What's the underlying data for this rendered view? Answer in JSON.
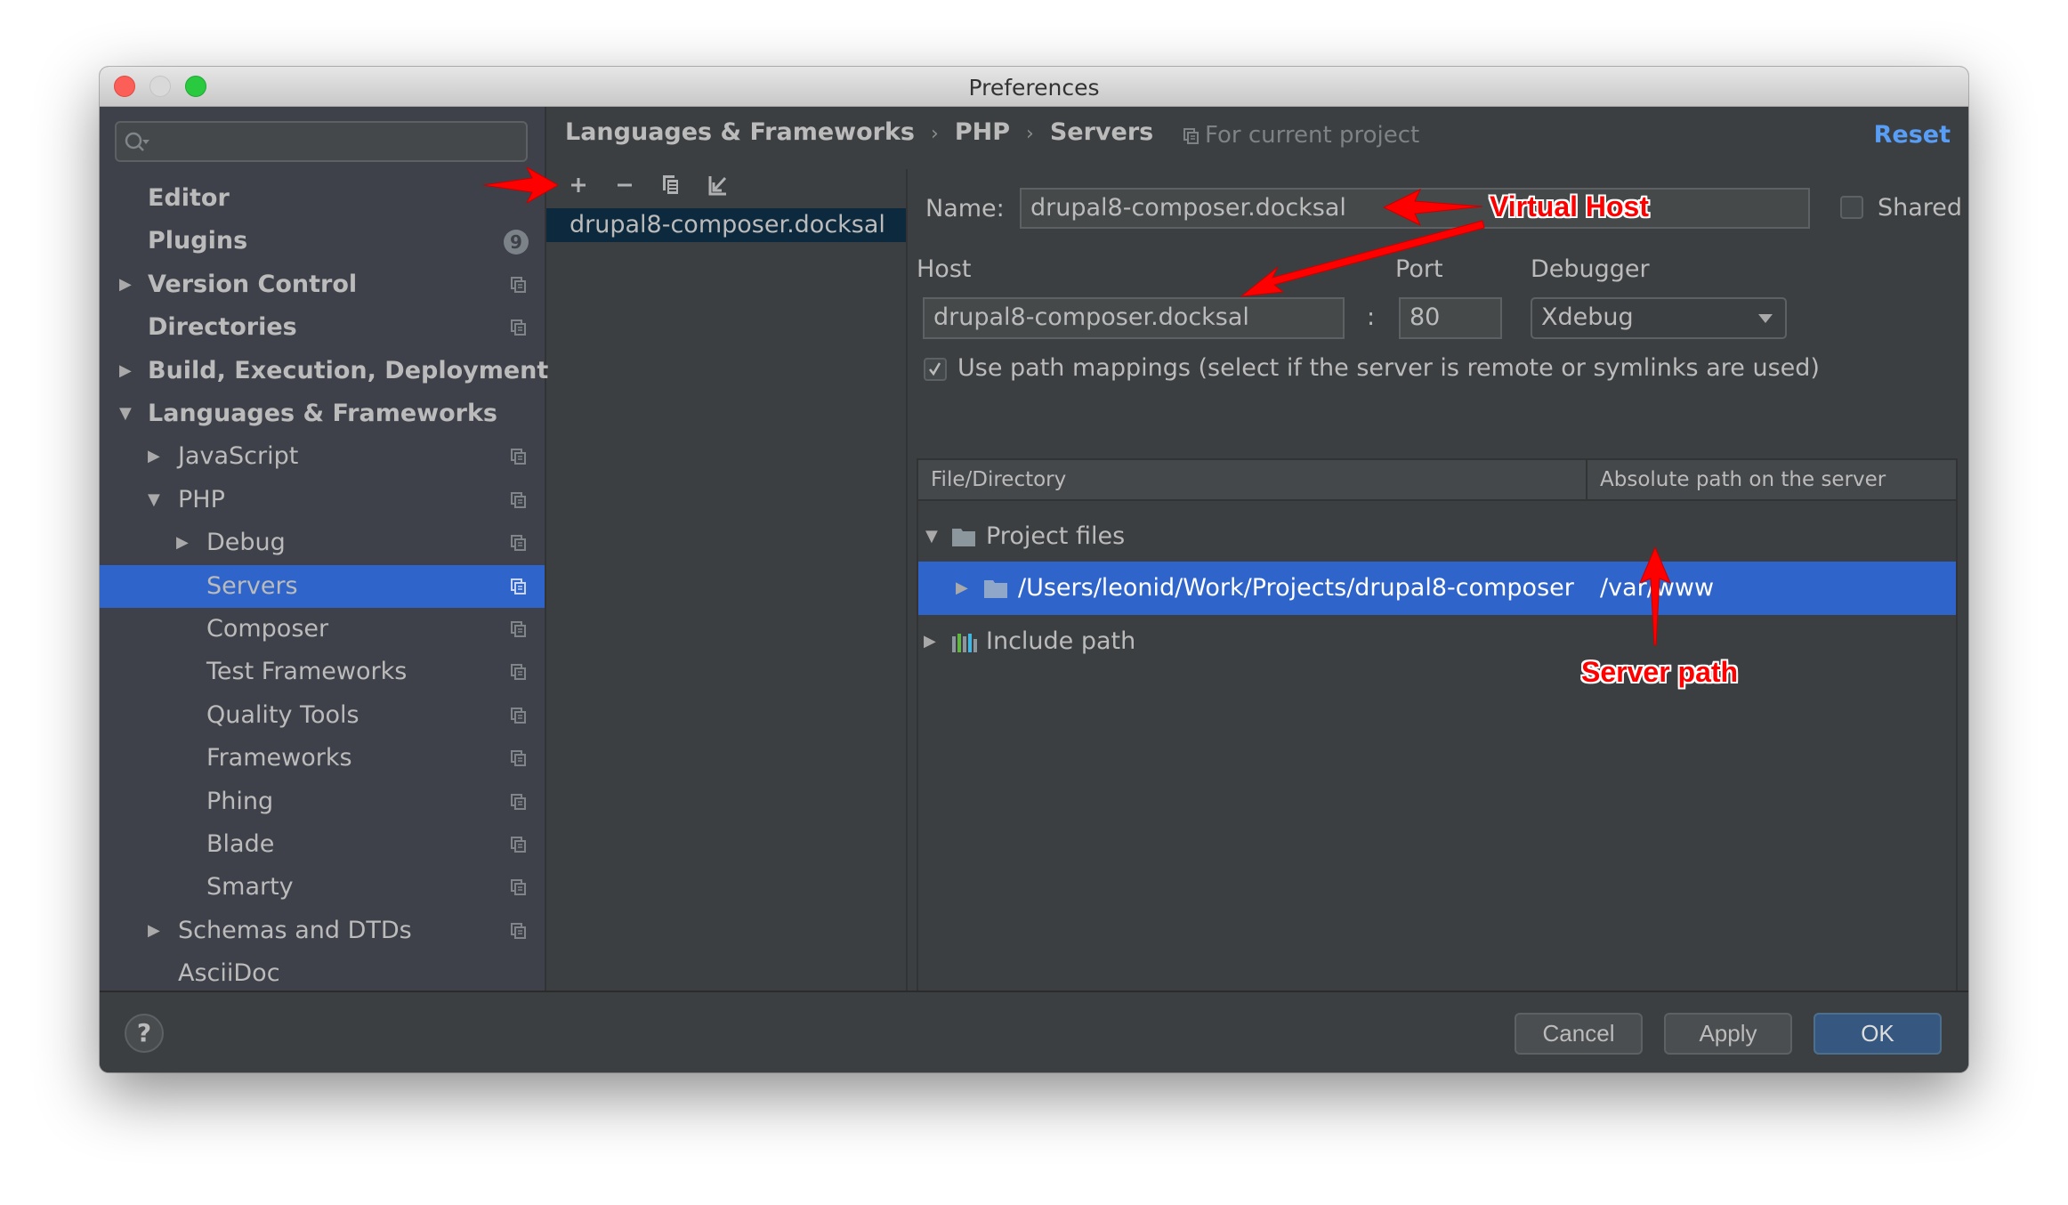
{
  "window": {
    "title": "Preferences",
    "controls": [
      "close",
      "minimize",
      "maximize"
    ]
  },
  "sidebar": {
    "search": {
      "value": "",
      "placeholder": ""
    },
    "items": [
      {
        "label": "Editor",
        "level": 0,
        "expander": "none",
        "bold": true,
        "project_icon": false
      },
      {
        "label": "Plugins",
        "level": 0,
        "expander": "none",
        "bold": true,
        "badge": "9"
      },
      {
        "label": "Version Control",
        "level": 0,
        "expander": "collapsed",
        "bold": true,
        "project_icon": true
      },
      {
        "label": "Directories",
        "level": 0,
        "expander": "none",
        "bold": true,
        "project_icon": true
      },
      {
        "label": "Build, Execution, Deployment",
        "level": 0,
        "expander": "collapsed",
        "bold": true,
        "project_icon": false
      },
      {
        "label": "Languages & Frameworks",
        "level": 0,
        "expander": "expanded",
        "bold": true,
        "project_icon": false
      },
      {
        "label": "JavaScript",
        "level": 1,
        "expander": "collapsed",
        "project_icon": true
      },
      {
        "label": "PHP",
        "level": 1,
        "expander": "expanded",
        "project_icon": true
      },
      {
        "label": "Debug",
        "level": 2,
        "expander": "collapsed",
        "project_icon": true
      },
      {
        "label": "Servers",
        "level": 2,
        "expander": "none",
        "project_icon": true,
        "selected": true
      },
      {
        "label": "Composer",
        "level": 2,
        "expander": "none",
        "project_icon": true
      },
      {
        "label": "Test Frameworks",
        "level": 2,
        "expander": "none",
        "project_icon": true
      },
      {
        "label": "Quality Tools",
        "level": 2,
        "expander": "none",
        "project_icon": true
      },
      {
        "label": "Frameworks",
        "level": 2,
        "expander": "none",
        "project_icon": true
      },
      {
        "label": "Phing",
        "level": 2,
        "expander": "none",
        "project_icon": true
      },
      {
        "label": "Blade",
        "level": 2,
        "expander": "none",
        "project_icon": true
      },
      {
        "label": "Smarty",
        "level": 2,
        "expander": "none",
        "project_icon": true
      },
      {
        "label": "Schemas and DTDs",
        "level": 1,
        "expander": "collapsed",
        "project_icon": true
      },
      {
        "label": "AsciiDoc",
        "level": 1,
        "expander": "none",
        "project_icon": false
      }
    ]
  },
  "header": {
    "breadcrumb": [
      "Languages & Frameworks",
      "PHP",
      "Servers"
    ],
    "breadcrumb_separator": "›",
    "scope_label": "For current project",
    "reset_label": "Reset"
  },
  "servers_list": {
    "toolbar": [
      {
        "name": "add",
        "icon": "plus-icon",
        "glyph": "+"
      },
      {
        "name": "remove",
        "icon": "minus-icon",
        "glyph": "−"
      },
      {
        "name": "copy",
        "icon": "copy-icon"
      },
      {
        "name": "import",
        "icon": "import-icon"
      }
    ],
    "items": [
      {
        "label": "drupal8-composer.docksal",
        "selected": true
      }
    ]
  },
  "server_form": {
    "name_label": "Name:",
    "name_value": "drupal8-composer.docksal",
    "shared_label": "Shared",
    "shared_checked": false,
    "host_label": "Host",
    "host_value": "drupal8-composer.docksal",
    "port_label": "Port",
    "port_separator": ":",
    "port_value": "80",
    "debugger_label": "Debugger",
    "debugger_value": "Xdebug",
    "path_mappings_label": "Use path mappings (select if the server is remote or symlinks are used)",
    "path_mappings_checked": true
  },
  "mappings_table": {
    "columns": [
      "File/Directory",
      "Absolute path on the server"
    ],
    "rows": [
      {
        "label": "Project files",
        "server_path": "",
        "expander": "expanded",
        "icon": "folder-icon",
        "level": 0,
        "selected": false
      },
      {
        "label": "/Users/leonid/Work/Projects/drupal8-composer",
        "server_path": "/var/www",
        "expander": "collapsed",
        "icon": "folder-icon",
        "level": 1,
        "selected": true
      },
      {
        "label": "Include path",
        "server_path": "",
        "expander": "collapsed",
        "icon": "library-icon",
        "level": 0,
        "selected": false
      }
    ]
  },
  "footer": {
    "help_label": "?",
    "cancel_label": "Cancel",
    "apply_label": "Apply",
    "ok_label": "OK"
  },
  "annotations": {
    "virtual_host": "Virtual Host",
    "server_path": "Server path",
    "color": "#ff0000"
  },
  "colors": {
    "selection": "#2f65ca",
    "list_selection": "#0d293e",
    "link": "#589df6",
    "panel": "#3c3f41",
    "sidebar": "#3e4149"
  }
}
